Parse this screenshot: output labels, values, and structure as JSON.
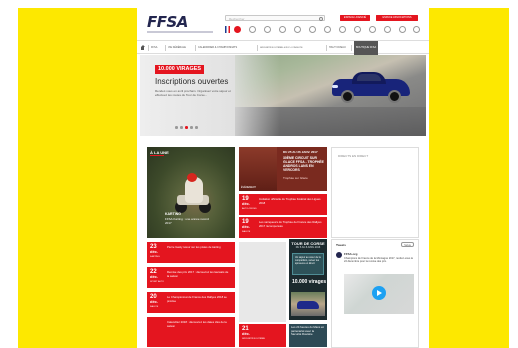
{
  "colors": {
    "accent": "#e4151f",
    "yellow": "#fde800",
    "navy": "#23264f"
  },
  "header": {
    "logo": "FFSA",
    "search_placeholder": "Rechercher",
    "btn_primary": "ESPACE LICENCIÉ",
    "btn_secondary": "ESPACE ASSOCIATIONS"
  },
  "nav": {
    "items": [
      "ffsa",
      "vie fédérale",
      "calendrier & championnats",
      "sécurité routière & éco-conduite",
      "haut niveau",
      "boutique ffsa"
    ]
  },
  "hero": {
    "tag": "10.000 VIRAGES",
    "title": "Inscriptions ouvertes",
    "subtitle": "Rendez-vous en avril prochain. Organisez votre séjour et effectuez les routes du Tour de Corse..."
  },
  "news": {
    "une_label": "À LA UNE",
    "une_category": "KARTING",
    "une_title": "FFSA Karting : une année record 2017",
    "featured": {
      "date": "DU 25 AU 26 JANV. 2017",
      "title": "30ème circuit sur glace FFSA - trophée Andros Lans en Vercors",
      "more": "Trophée sur Glace",
      "photo_label": "ÉVÈNEMENT"
    },
    "cards": [
      {
        "day": "19",
        "month": "déc.",
        "cat": "AUTO-CROSS",
        "title": "Invitation officielle du Trophée Fédéral des Ligues 2018"
      },
      {
        "day": "19",
        "month": "déc.",
        "cat": "RALLYE",
        "title": "Les vainqueurs du Trophée de France des Rallyes 2017 récompensés"
      },
      {
        "day": "23",
        "month": "déc.",
        "cat": "KARTING",
        "title": "Pierre Gasly retour sur les pistes de karting"
      },
      {
        "day": "22",
        "month": "déc.",
        "cat": "SPORT AUTO",
        "title": "Remise des prix 2017 : découvrez les lauréats de la saison"
      },
      {
        "day": "20",
        "month": "déc.",
        "cat": "RALLYE",
        "title": "Le Championnat de France des Rallyes 2018 se précise"
      },
      {
        "day": "",
        "month": "",
        "cat": "",
        "title": "Calendrier 2018 : découvrez les dates clés de la saison"
      },
      {
        "day": "21",
        "month": "déc.",
        "cat": "SÉCURITÉ ROUTIÈRE",
        "title": "Les 24 heures du Mans en partenariat avec la Sécurité Routière"
      }
    ],
    "direct_title": "DIRECTS EN DIRECT",
    "tour": {
      "title": "TOUR DE CORSE",
      "subtitle": "DU 5 AU 8 AVRIL 2018",
      "body": "Un séjour au cœur de la compétition, suivez les épreuves en direct",
      "logo": "10.000 virages"
    },
    "twitter": {
      "header": "Tweets",
      "follow": "Suivre",
      "name": "FFSA.org",
      "text": "Champions de France de la Montagne 2017, rendez-vous le 22 décembre pour la remise des prix."
    }
  }
}
